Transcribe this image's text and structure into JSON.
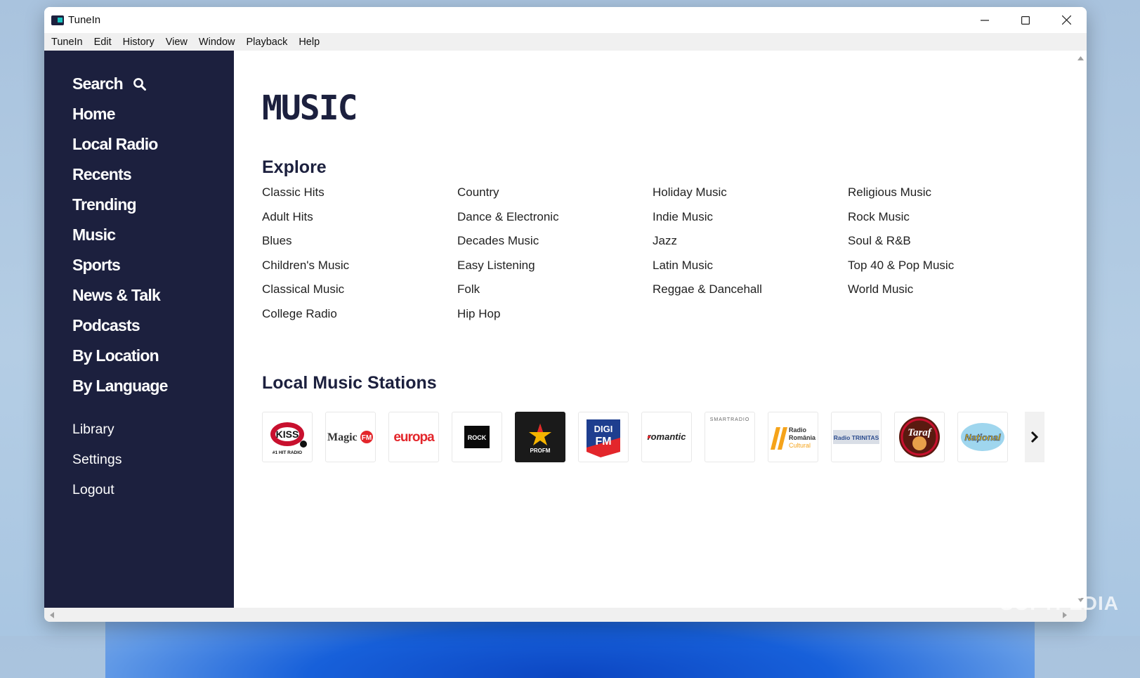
{
  "window": {
    "title": "TuneIn"
  },
  "menu": [
    "TuneIn",
    "Edit",
    "History",
    "View",
    "Window",
    "Playback",
    "Help"
  ],
  "sidebar": {
    "nav": [
      "Search",
      "Home",
      "Local Radio",
      "Recents",
      "Trending",
      "Music",
      "Sports",
      "News & Talk",
      "Podcasts",
      "By Location",
      "By Language"
    ],
    "lower": [
      "Library",
      "Settings",
      "Logout"
    ]
  },
  "main": {
    "title": "MUSIC",
    "explore": {
      "heading": "Explore",
      "columns": [
        [
          "Classic Hits",
          "Adult Hits",
          "Blues",
          "Children's Music",
          "Classical Music",
          "College Radio"
        ],
        [
          "Country",
          "Dance & Electronic",
          "Decades Music",
          "Easy Listening",
          "Folk",
          "Hip Hop"
        ],
        [
          "Holiday Music",
          "Indie Music",
          "Jazz",
          "Latin Music",
          "Reggae & Dancehall"
        ],
        [
          "Religious Music",
          "Rock Music",
          "Soul & R&B",
          "Top 40 & Pop Music",
          "World Music"
        ]
      ]
    },
    "stations": {
      "heading": "Local Music Stations",
      "items": [
        {
          "logo": [
            "KISS",
            "#1 HIT RADIO"
          ]
        },
        {
          "logo": [
            "Magic",
            "FM"
          ]
        },
        {
          "logo": [
            "europa"
          ]
        },
        {
          "logo": [
            "ROCK"
          ]
        },
        {
          "logo": [
            "PROFM"
          ]
        },
        {
          "logo": [
            "DIGI",
            "FM"
          ]
        },
        {
          "logo": [
            "romantic"
          ]
        },
        {
          "logo": [
            "SMARTRADIO"
          ]
        },
        {
          "logo": [
            "Radio",
            "România",
            "Cultural"
          ]
        },
        {
          "logo": [
            "Radio TRINITAS"
          ]
        },
        {
          "logo": [
            "Taraf"
          ]
        },
        {
          "logo": [
            "Național"
          ]
        }
      ]
    }
  },
  "watermark": "SOFTPEDIA"
}
